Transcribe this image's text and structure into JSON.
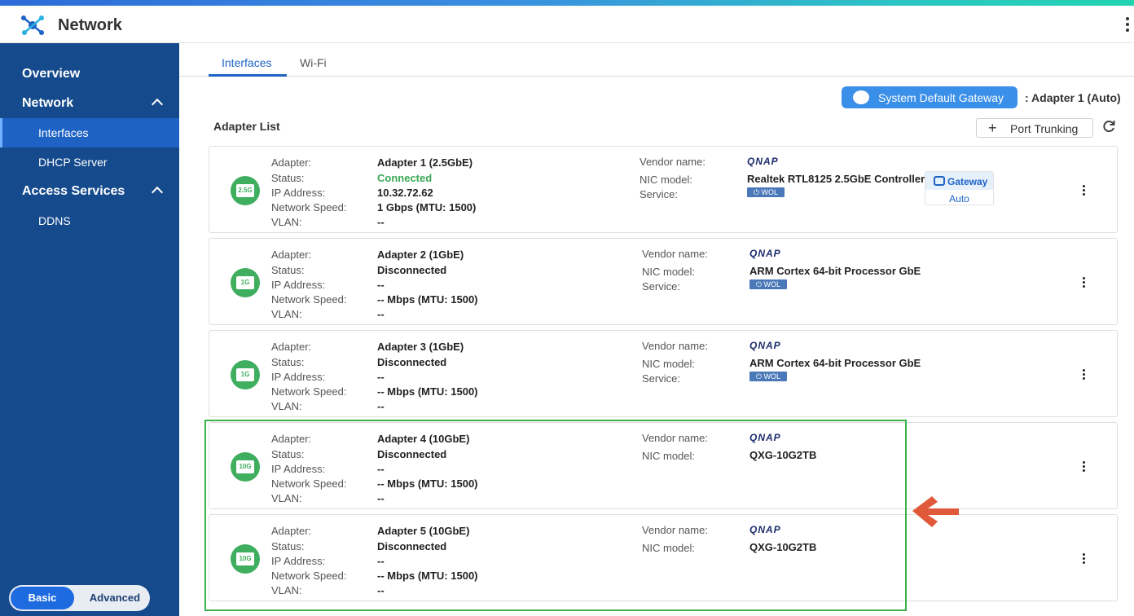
{
  "app": {
    "title": "Network"
  },
  "sidebar": {
    "items": [
      {
        "label": "Overview"
      },
      {
        "label": "Network"
      },
      {
        "label": "Interfaces"
      },
      {
        "label": "DHCP Server"
      },
      {
        "label": "Access Services"
      },
      {
        "label": "DDNS"
      }
    ],
    "mode": {
      "basic": "Basic",
      "advanced": "Advanced"
    }
  },
  "tabs": [
    {
      "label": "Interfaces"
    },
    {
      "label": "Wi-Fi"
    }
  ],
  "gateway": {
    "button": "System Default Gateway",
    "value": ": Adapter 1 (Auto)"
  },
  "list": {
    "title": "Adapter List",
    "port_trunking": "Port Trunking"
  },
  "labels": {
    "adapter": "Adapter:",
    "status": "Status:",
    "ip": "IP Address:",
    "speed": "Network Speed:",
    "vlan": "VLAN:",
    "vendor": "Vendor name:",
    "nic": "NIC model:",
    "service": "Service:"
  },
  "vendor_logo": "QNAP",
  "wol_label": "WOL",
  "gateway_tag": {
    "label": "Gateway",
    "mode": "Auto"
  },
  "adapters": [
    {
      "badge": "2.5G",
      "name": "Adapter 1 (2.5GbE)",
      "status": "Connected",
      "ip": "10.32.72.62",
      "speed": "1 Gbps (MTU: 1500)",
      "vlan": "--",
      "nic": "Realtek RTL8125 2.5GbE Controller"
    },
    {
      "badge": "1G",
      "name": "Adapter 2 (1GbE)",
      "status": "Disconnected",
      "ip": "--",
      "speed": "-- Mbps (MTU: 1500)",
      "vlan": "--",
      "nic": "ARM Cortex 64-bit Processor GbE"
    },
    {
      "badge": "1G",
      "name": "Adapter 3 (1GbE)",
      "status": "Disconnected",
      "ip": "--",
      "speed": "-- Mbps (MTU: 1500)",
      "vlan": "--",
      "nic": "ARM Cortex 64-bit Processor GbE"
    },
    {
      "badge": "10G",
      "name": "Adapter 4 (10GbE)",
      "status": "Disconnected",
      "ip": "--",
      "speed": "-- Mbps (MTU: 1500)",
      "vlan": "--",
      "nic": "QXG-10G2TB"
    },
    {
      "badge": "10G",
      "name": "Adapter 5 (10GbE)",
      "status": "Disconnected",
      "ip": "--",
      "speed": "-- Mbps (MTU: 1500)",
      "vlan": "--",
      "nic": "QXG-10G2TB"
    }
  ],
  "colors": {
    "sidebar": "#154a8c",
    "accent": "#1e63c4",
    "connected": "#3aa856",
    "highlight": "#3bb14a",
    "arrow": "#e0593a"
  }
}
